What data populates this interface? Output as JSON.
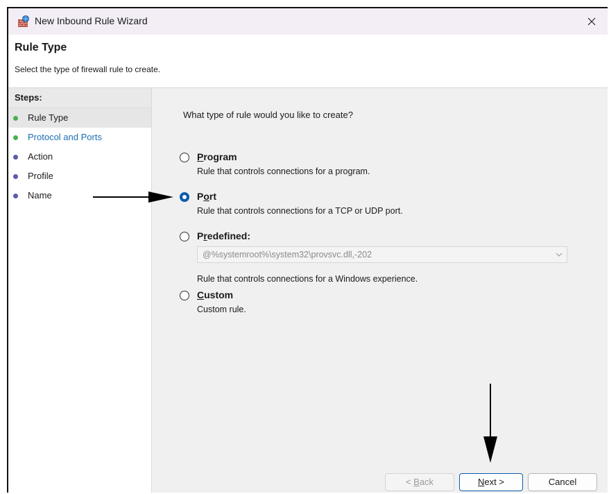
{
  "window": {
    "title": "New Inbound Rule Wizard"
  },
  "header": {
    "title": "Rule Type",
    "subtitle": "Select the type of firewall rule to create."
  },
  "steps": {
    "heading": "Steps:",
    "items": [
      {
        "label": "Rule Type"
      },
      {
        "label": "Protocol and Ports"
      },
      {
        "label": "Action"
      },
      {
        "label": "Profile"
      },
      {
        "label": "Name"
      }
    ]
  },
  "main": {
    "question": "What type of rule would you like to create?",
    "options": [
      {
        "accel": "P",
        "rest": "rogram",
        "description": "Rule that controls connections for a program.",
        "selected": false
      },
      {
        "accel": "P",
        "rest": "ort",
        "accel_position": "second",
        "description": "Rule that controls connections for a TCP or UDP port.",
        "selected": true
      },
      {
        "prefix": "P",
        "accel": "r",
        "rest": "edefined:",
        "description": "Rule that controls connections for a Windows experience.",
        "selected": false
      },
      {
        "accel": "C",
        "rest": "ustom",
        "description": "Custom rule.",
        "selected": false
      }
    ],
    "predefined_select_value": "@%systemroot%\\system32\\provsvc.dll,-202"
  },
  "buttons": {
    "back": {
      "prefix": "< ",
      "accel": "B",
      "rest": "ack",
      "enabled": false
    },
    "next": {
      "accel": "N",
      "rest": "ext >",
      "enabled": true
    },
    "cancel": {
      "label": "Cancel",
      "enabled": true
    }
  },
  "colors": {
    "accent": "#0b5cad",
    "link": "#1b6fb5",
    "completed_step_dot": "#4caf50",
    "pending_step_dot": "#5b5bb0",
    "titlebar": "#f3eef6"
  },
  "icons": {
    "title": "firewall-icon",
    "close": "close-icon",
    "dropdown": "chevron-down-icon"
  }
}
